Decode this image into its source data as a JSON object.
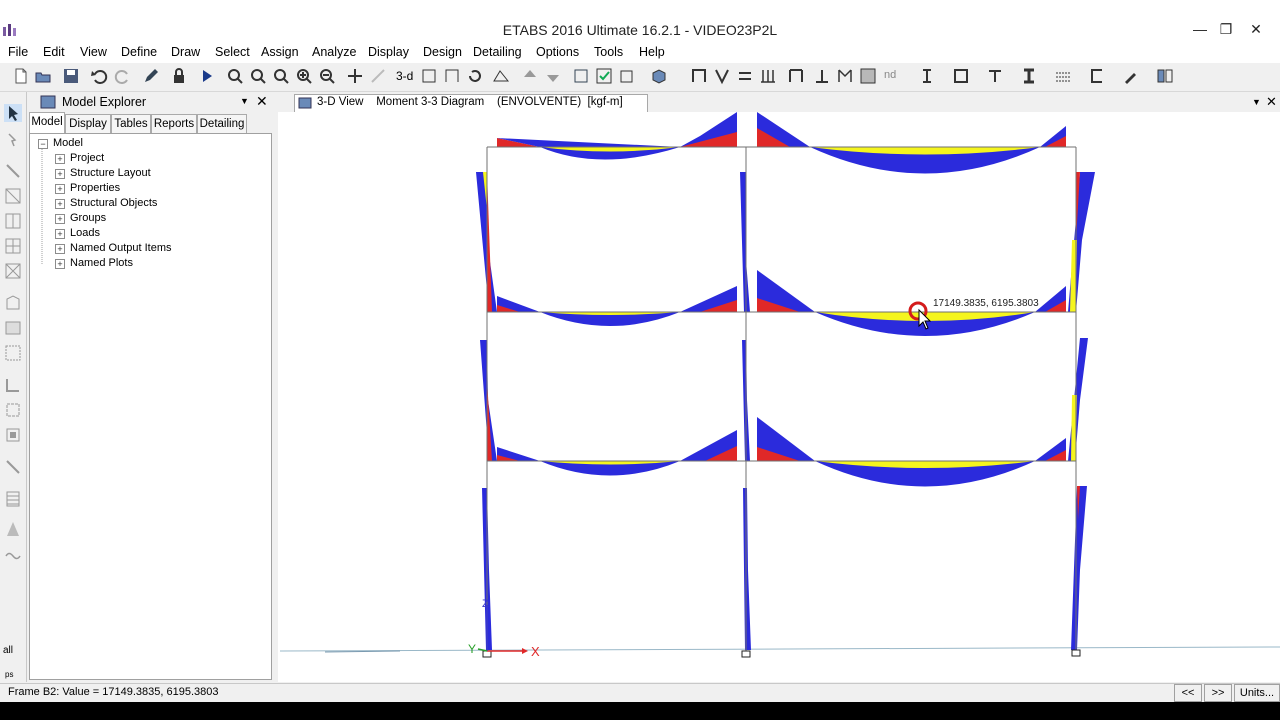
{
  "window": {
    "title": "ETABS 2016 Ultimate 16.2.1 - VIDEO23P2L",
    "minimize_glyph": "—",
    "maximize_glyph": "❐",
    "close_glyph": "✕"
  },
  "menu": [
    "File",
    "Edit",
    "View",
    "Define",
    "Draw",
    "Select",
    "Assign",
    "Analyze",
    "Display",
    "Design",
    "Detailing",
    "Options",
    "Tools",
    "Help"
  ],
  "toolbar": {
    "view_3d_label": "3-d",
    "view_nd_label": "nd"
  },
  "explorer": {
    "title": "Model Explorer",
    "tabs": [
      "Model",
      "Display",
      "Tables",
      "Reports",
      "Detailing"
    ],
    "active_tab": "Model",
    "root": "Model",
    "items": [
      "Project",
      "Structure Layout",
      "Properties",
      "Structural Objects",
      "Groups",
      "Loads",
      "Named Output Items",
      "Named Plots"
    ]
  },
  "left_tools": {
    "all_label": "all",
    "ps_label": "ps"
  },
  "view": {
    "tab_label": "3-D View    Moment 3-3 Diagram    (ENVOLVENTE)  [kgf-m]",
    "tooltip_value": "17149.3835, 6195.3803",
    "axis_x_label": "X",
    "axis_y_label": "Y",
    "axis_z_label": "Z"
  },
  "status": {
    "text": "Frame B2:  Value = 17149.3835, 6195.3803",
    "prev_label": "<<",
    "next_label": ">>",
    "units_label": "Units..."
  },
  "colors": {
    "negative_moment": "#2b2bdc",
    "positive_moment": "#f5f51e",
    "reaction_red": "#e02828",
    "frame_line": "#6a6a6a",
    "cursor_circle": "#d41c1c"
  }
}
